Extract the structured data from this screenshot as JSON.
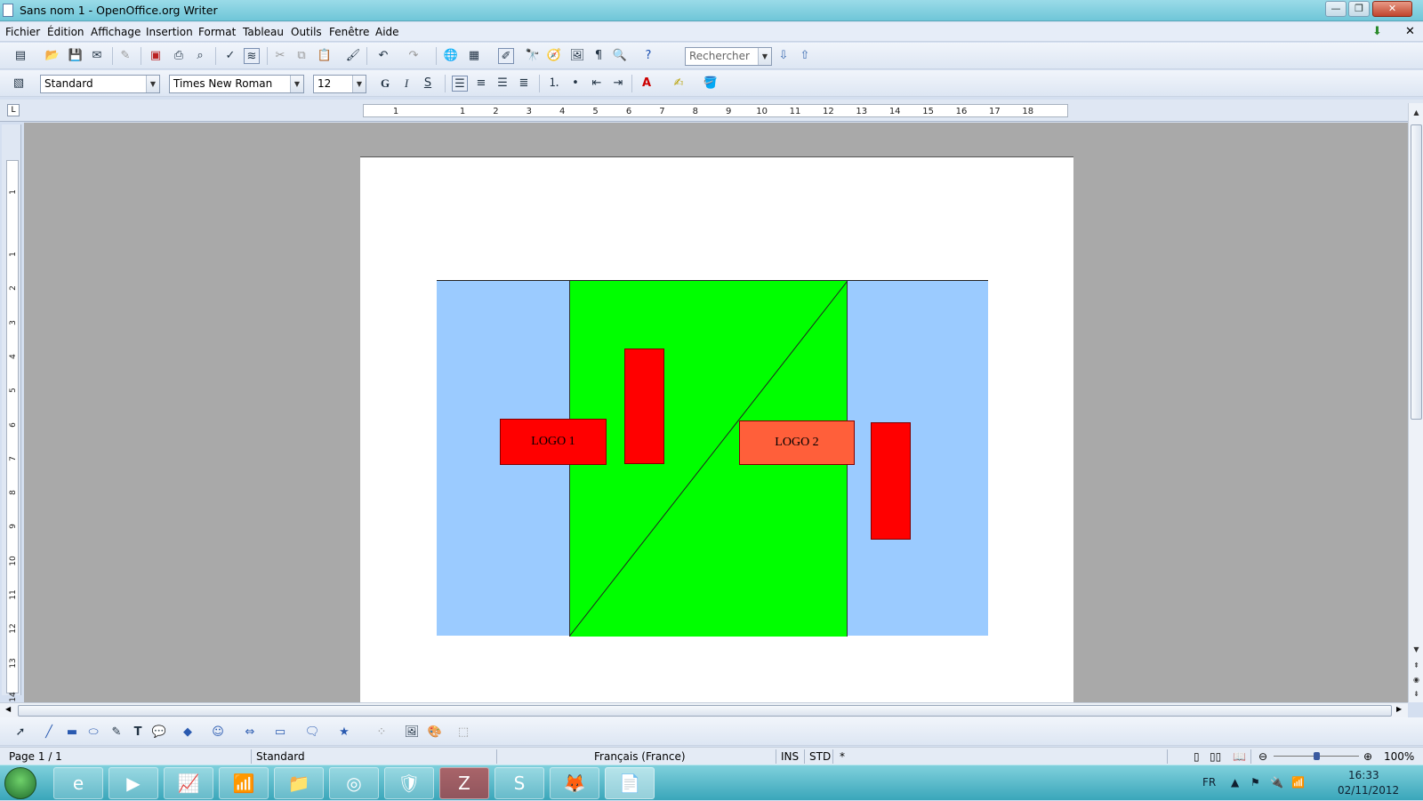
{
  "window": {
    "title": "Sans nom 1 - OpenOffice.org Writer",
    "controls": {
      "minimize": "—",
      "maximize": "❐",
      "close": "✕"
    }
  },
  "menu": {
    "items": [
      "Fichier",
      "Édition",
      "Affichage",
      "Insertion",
      "Format",
      "Tableau",
      "Outils",
      "Fenêtre",
      "Aide"
    ],
    "close_doc": "✕"
  },
  "formatting": {
    "style": "Standard",
    "font": "Times New Roman",
    "size": "12",
    "bold": "G",
    "italic": "I",
    "underline": "S"
  },
  "search": {
    "placeholder": "Rechercher"
  },
  "ruler": {
    "h_labels": [
      "1",
      "1",
      "2",
      "3",
      "4",
      "5",
      "6",
      "7",
      "8",
      "9",
      "10",
      "11",
      "12",
      "13",
      "14",
      "15",
      "16",
      "17",
      "18"
    ],
    "v_labels": [
      "1",
      "1",
      "2",
      "3",
      "4",
      "5",
      "6",
      "7",
      "8",
      "9",
      "10",
      "11",
      "12",
      "13",
      "14"
    ],
    "tab_marker": "L"
  },
  "document": {
    "logo1": "LOGO 1",
    "logo2": "LOGO 2",
    "colors": {
      "background": "#9bcbff",
      "center_panel": "#00ff00",
      "red_block": "#ff0000",
      "logo1_fill": "#ff0000",
      "logo2_fill": "#ff5f3a"
    }
  },
  "status": {
    "page": "Page 1 / 1",
    "style": "Standard",
    "language": "Français (France)",
    "ins": "INS",
    "std": "STD",
    "modified": "*",
    "zoom": "100%"
  },
  "taskbar": {
    "apps": [
      "internet-explorer",
      "media-player",
      "stock-chart",
      "wifi-manager",
      "file-explorer",
      "chrome",
      "security",
      "filezilla",
      "sublime-text",
      "firefox",
      "openoffice-writer"
    ],
    "lang": "FR",
    "time": "16:33",
    "date": "02/11/2012"
  }
}
